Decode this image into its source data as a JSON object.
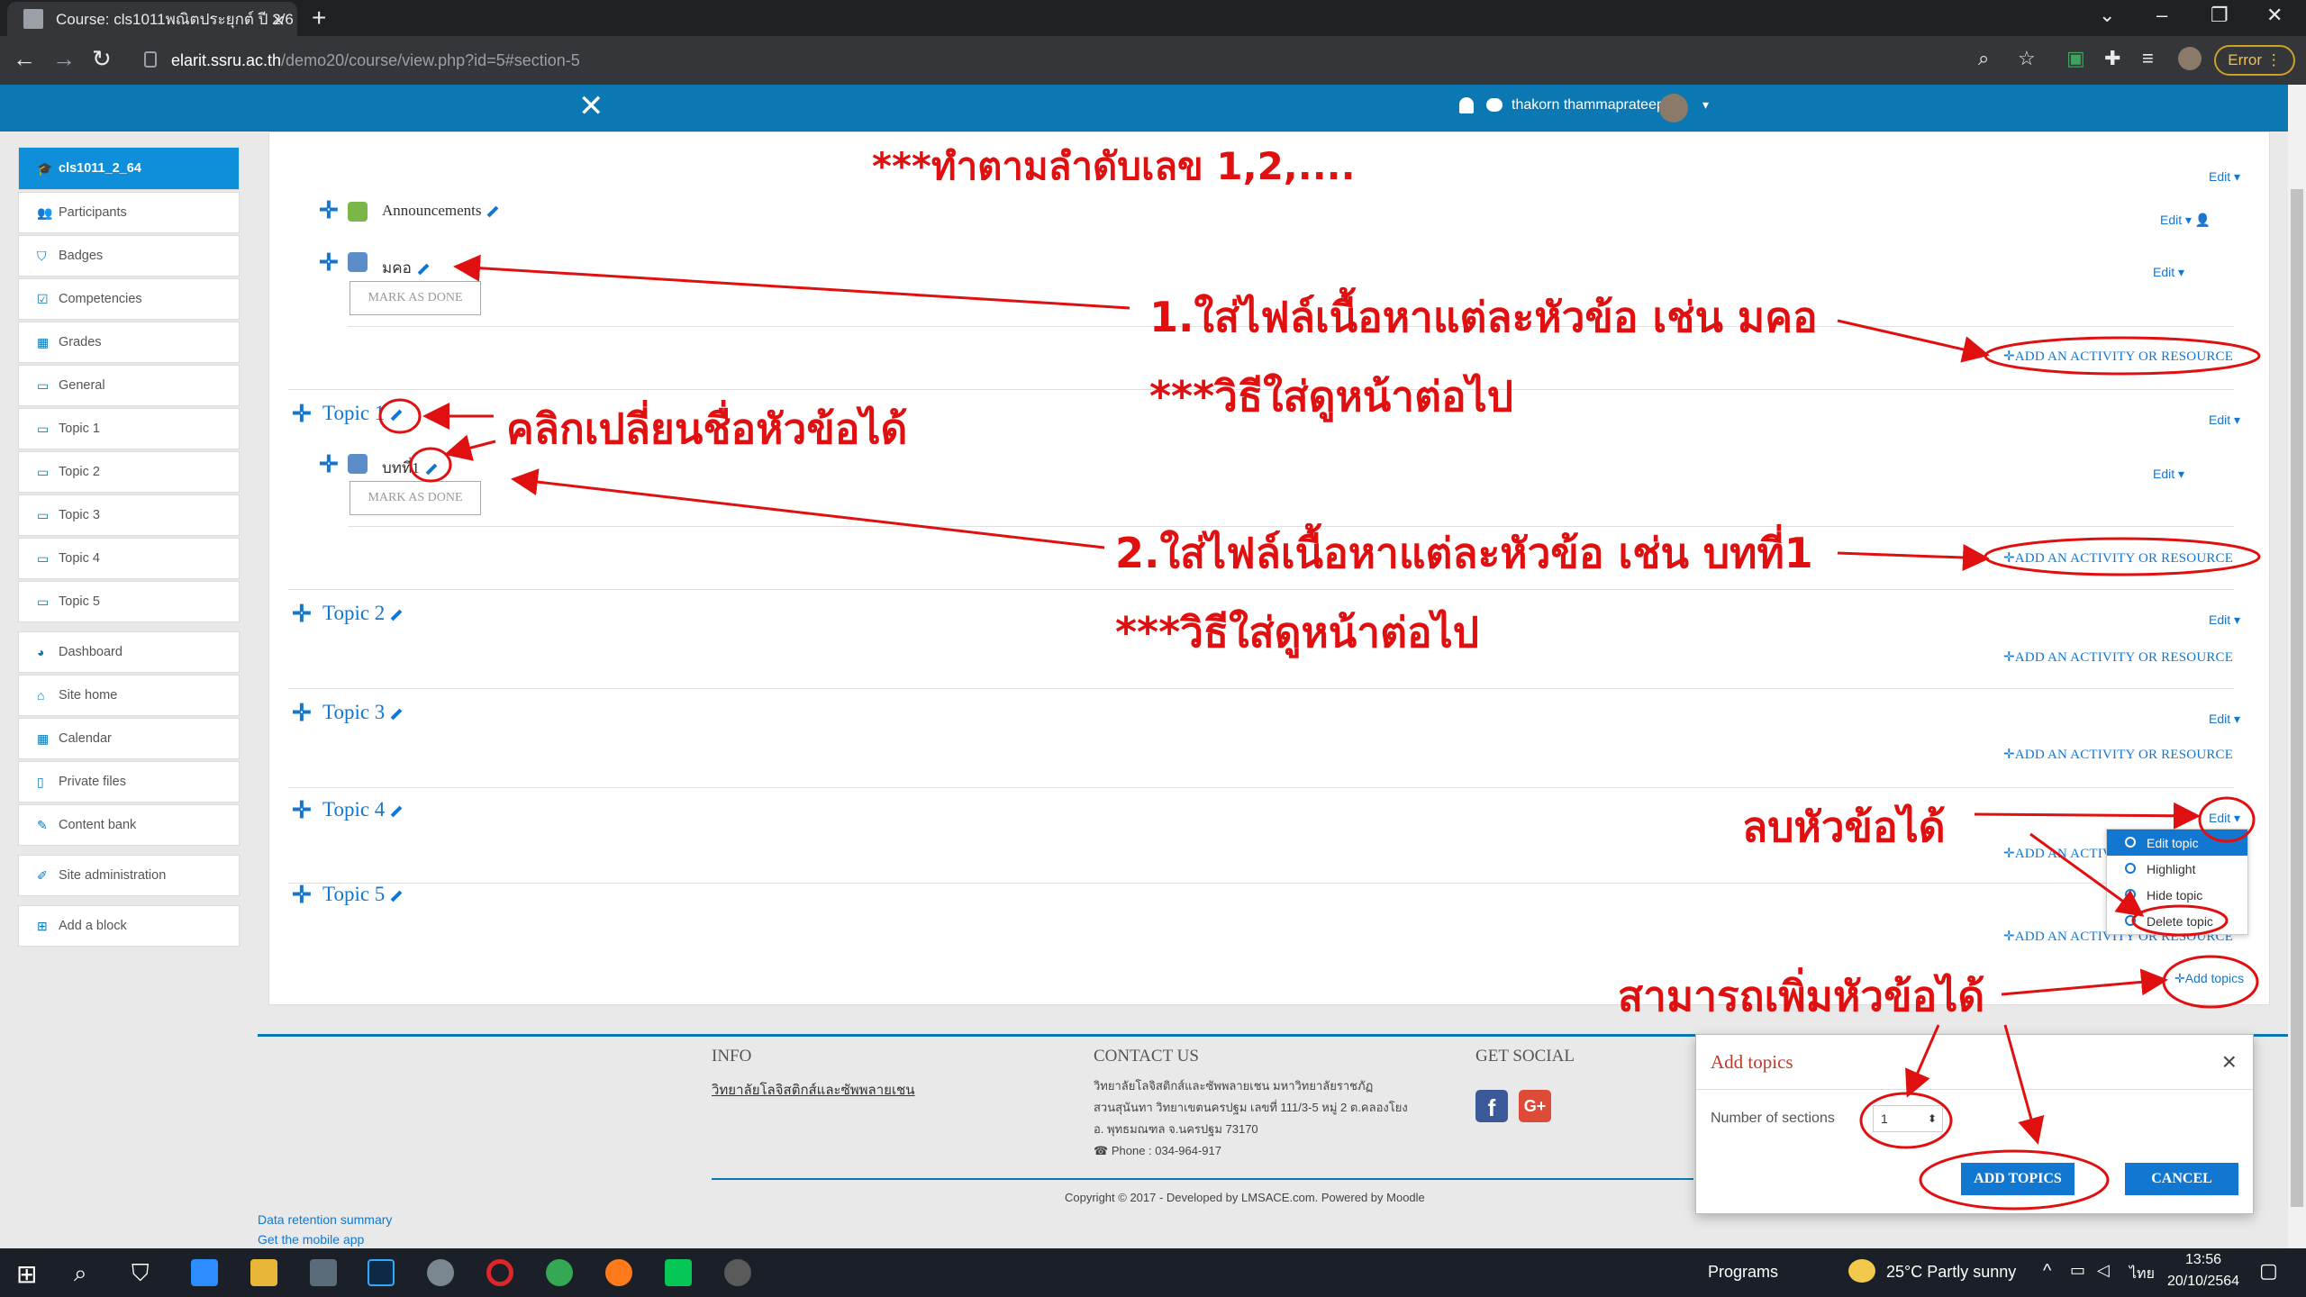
{
  "browser": {
    "tab_title": "Course: cls1011พณิตประยุกต์ ปี 2/6",
    "tab_close": "×",
    "new_tab": "+",
    "url_host": "elarit.ssru.ac.th",
    "url_path": "/demo20/course/view.php?id=5#section-5",
    "error_label": "Error",
    "back": "←",
    "forward": "→",
    "reload": "↻",
    "win_min": "–",
    "win_max": "❐",
    "win_close": "✕",
    "win_chevron": "⌄"
  },
  "navbar": {
    "close": "✕",
    "user_name": "thakorn thammaprateep",
    "caret": "▾"
  },
  "sidebar": {
    "items": [
      {
        "label": "cls1011_2_64",
        "icon": "graduation-cap-icon",
        "glyph": "🎓"
      },
      {
        "label": "Participants",
        "icon": "users-icon",
        "glyph": "👥"
      },
      {
        "label": "Badges",
        "icon": "shield-icon",
        "glyph": "⛉"
      },
      {
        "label": "Competencies",
        "icon": "check-square-icon",
        "glyph": "☑"
      },
      {
        "label": "Grades",
        "icon": "table-icon",
        "glyph": "▦"
      },
      {
        "label": "General",
        "icon": "folder-icon",
        "glyph": "▭"
      },
      {
        "label": "Topic 1",
        "icon": "folder-icon",
        "glyph": "▭"
      },
      {
        "label": "Topic 2",
        "icon": "folder-icon",
        "glyph": "▭"
      },
      {
        "label": "Topic 3",
        "icon": "folder-icon",
        "glyph": "▭"
      },
      {
        "label": "Topic 4",
        "icon": "folder-icon",
        "glyph": "▭"
      },
      {
        "label": "Topic 5",
        "icon": "folder-icon",
        "glyph": "▭"
      },
      {
        "label": "Dashboard",
        "icon": "dashboard-icon",
        "glyph": "◕"
      },
      {
        "label": "Site home",
        "icon": "home-icon",
        "glyph": "⌂"
      },
      {
        "label": "Calendar",
        "icon": "calendar-icon",
        "glyph": "▦"
      },
      {
        "label": "Private files",
        "icon": "file-icon",
        "glyph": "▯"
      },
      {
        "label": "Content bank",
        "icon": "paintbrush-icon",
        "glyph": "✎"
      },
      {
        "label": "Site administration",
        "icon": "wrench-icon",
        "glyph": "✐"
      },
      {
        "label": "Add a block",
        "icon": "plus-square-icon",
        "glyph": "⊞"
      }
    ]
  },
  "main": {
    "edit_label": "Edit",
    "caret": "▾",
    "plus": "✛",
    "add_activity": "✛ADD AN ACTIVITY OR RESOURCE",
    "mark_as_done": "MARK AS DONE",
    "general": {
      "announcements": "Announcements",
      "activity": "มคอ"
    },
    "topics": [
      {
        "name": "Topic 1",
        "activity": "บทที่1"
      },
      {
        "name": "Topic 2"
      },
      {
        "name": "Topic 3"
      },
      {
        "name": "Topic 4"
      },
      {
        "name": "Topic 5"
      }
    ],
    "add_topics": "✛Add topics",
    "dropdown": [
      "Edit topic",
      "Highlight",
      "Hide topic",
      "Delete topic"
    ]
  },
  "footer": {
    "info_title": "INFO",
    "info_link": "วิทยาลัยโลจิสติกส์และซัพพลายเชน",
    "contact_title": "CONTACT US",
    "contact_lines": [
      "วิทยาลัยโลจิสติกส์และซัพพลายเชน มหาวิทยาลัยราชภัฏ",
      "สวนสุนันทา วิทยาเขตนครปฐม เลขที่ 111/3-5 หมู่ 2 ต.คลองโยง",
      "อ. พุทธมณฑล จ.นครปฐม 73170",
      "Phone : 034-964-917"
    ],
    "social_title": "GET SOCIAL",
    "copyright": "Copyright © 2017 - Developed by LMSACE.com. Powered by Moodle",
    "data_retention": "Data retention summary",
    "mobile_app": "Get the mobile app"
  },
  "modal": {
    "title": "Add topics",
    "close": "×",
    "label": "Number of sections",
    "value": "1",
    "add_button": "ADD TOPICS",
    "cancel_button": "CANCEL"
  },
  "annotations": {
    "order_note": "***ทำตามลำดับเลข 1,2,....",
    "step1": "1.ใส่ไฟล์เนื้อหาแต่ละหัวข้อ เช่น มคอ",
    "step1_note": "***วิธีใส่ดูหน้าต่อไป",
    "rename": "คลิกเปลี่ยนชื่อหัวข้อได้",
    "step2": "2.ใส่ไฟล์เนื้อหาแต่ละหัวข้อ เช่น บทที่1",
    "step2_note": "***วิธีใส่ดูหน้าต่อไป",
    "delete": "ลบหัวข้อได้",
    "add": "สามารถเพิ่มหัวข้อได้"
  },
  "taskbar": {
    "programs": "Programs",
    "weather": "25°C  Partly sunny",
    "lang": "ไทย",
    "time": "13:56",
    "date": "20/10/2564"
  },
  "colors": {
    "annotation": "#e01010",
    "moodle_blue": "#0c78b3",
    "link_blue": "#1177d1"
  }
}
